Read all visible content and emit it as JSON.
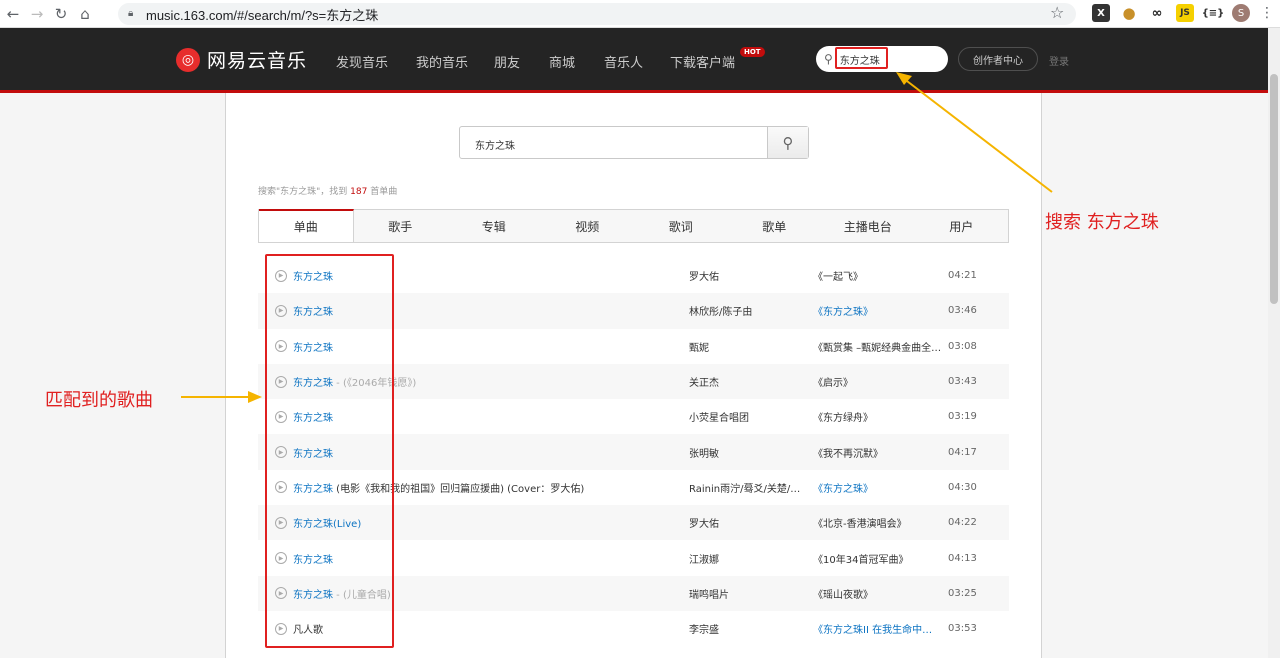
{
  "browser": {
    "url": "music.163.com/#/search/m/?s=东方之珠",
    "avatar_letter": "S",
    "ext_js": "JS",
    "ext_brace": "{≡}"
  },
  "nav": {
    "logo": "网易云音乐",
    "items": [
      "发现音乐",
      "我的音乐",
      "朋友",
      "商城",
      "音乐人",
      "下载客户端"
    ],
    "hot": "HOT",
    "search_value": "东方之珠",
    "creator": "创作者中心",
    "login": "登录"
  },
  "search": {
    "value": "东方之珠",
    "summary_prefix": "搜索\"东方之珠\"，找到",
    "summary_count": "187",
    "summary_suffix": "首单曲"
  },
  "tabs": [
    "单曲",
    "歌手",
    "专辑",
    "视频",
    "歌词",
    "歌单",
    "主播电台",
    "用户"
  ],
  "songs": [
    {
      "name": "东方之珠",
      "sub": "",
      "extra": "",
      "artist": "罗大佑",
      "album": "《一起飞》",
      "album_link": false,
      "duration": "04:21"
    },
    {
      "name": "东方之珠",
      "sub": "",
      "extra": "",
      "artist": "林欣彤/陈子由",
      "album": "《东方之珠》",
      "album_link": true,
      "duration": "03:46"
    },
    {
      "name": "东方之珠",
      "sub": "",
      "extra": "",
      "artist": "甄妮",
      "album": "《甄赏集 –甄妮经典金曲全…",
      "album_link": false,
      "duration": "03:08"
    },
    {
      "name": "东方之珠",
      "sub": " - (《2046年钱愿》)",
      "extra": "",
      "artist": "关正杰",
      "album": "《启示》",
      "album_link": false,
      "duration": "03:43"
    },
    {
      "name": "东方之珠",
      "sub": "",
      "extra": "",
      "artist": "小荧星合唱团",
      "album": "《东方绿舟》",
      "album_link": false,
      "duration": "03:19"
    },
    {
      "name": "东方之珠",
      "sub": "",
      "extra": "",
      "artist": "张明敏",
      "album": "《我不再沉默》",
      "album_link": false,
      "duration": "04:17"
    },
    {
      "name": "东方之珠",
      "sub": "",
      "extra": " (电影《我和我的祖国》回归篇应援曲)  (Cover：罗大佑)",
      "artist": "Rainin雨泞/蓦爻/关楚/…",
      "album": "《东方之珠》",
      "album_link": true,
      "duration": "04:30"
    },
    {
      "name": "东方之珠(Live)",
      "sub": "",
      "extra": "",
      "artist": "罗大佑",
      "album": "《北京-香港演唱会》",
      "album_link": false,
      "duration": "04:22"
    },
    {
      "name": "东方之珠",
      "sub": "",
      "extra": "",
      "artist": "江淑娜",
      "album": "《10年34首冠军曲》",
      "album_link": false,
      "duration": "04:13"
    },
    {
      "name": "东方之珠",
      "sub": " - (儿童合唱)",
      "extra": "",
      "artist": "瑞鸣唱片",
      "album": "《瑶山夜歌》",
      "album_link": false,
      "duration": "03:25"
    },
    {
      "name": "凡人歌",
      "sub": "",
      "extra": "",
      "artist": "李宗盛",
      "album": "《东方之珠II 在我生命中…",
      "album_link": true,
      "duration": "03:53",
      "plain": true
    }
  ],
  "annotations": {
    "search_note": "搜索 东方之珠",
    "match_note": "匹配到的歌曲",
    "color": "#e02020",
    "arrow_color": "#f5b400"
  }
}
